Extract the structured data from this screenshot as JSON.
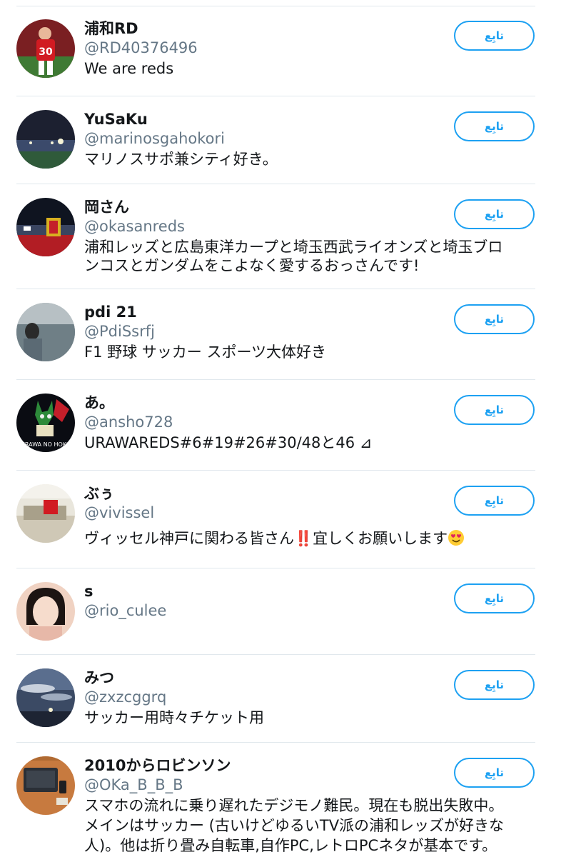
{
  "follow_label": "تابِع",
  "users": [
    {
      "name": "浦和RD",
      "handle": "@RD40376496",
      "bio": [
        "We are reds"
      ]
    },
    {
      "name": "YuSaKu",
      "handle": "@marinosgahokori",
      "bio": [
        "マリノスサポ兼シティ好き。"
      ]
    },
    {
      "name": "岡さん",
      "handle": "@okasanreds",
      "bio": [
        "浦和レッズと広島東洋カープと埼玉西武ライオンズと埼玉ブロ",
        "ンコスとガンダムをこよなく愛するおっさんです!"
      ]
    },
    {
      "name": "pdi 21",
      "handle": "@PdiSsrfj",
      "bio": [
        "F1 野球 サッカー スポーツ大体好き"
      ]
    },
    {
      "name": "あ。",
      "handle": "@ansho728",
      "bio": [
        "URAWAREDS#6#19#26#30/48と46 ⊿"
      ],
      "avatar_text": "URAWA NO HOKO"
    },
    {
      "name": "ぶぅ",
      "handle": "@vivissel",
      "bio_parts": {
        "before": "ヴィッセル神戸に関わる皆さん",
        "bang": "‼️",
        "after": "宜しくお願いします"
      }
    },
    {
      "name": "s",
      "handle": "@rio_culee",
      "bio": []
    },
    {
      "name": "みつ",
      "handle": "@zxzcggrq",
      "bio": [
        "サッカー用時々チケット用"
      ]
    },
    {
      "name": "2010からロビンソン",
      "handle": "@OKa_B_B_B",
      "bio": [
        "スマホの流れに乗り遅れたデジモノ難民。現在も脱出失敗中。",
        "メインはサッカー (古いけどゆるいTV派の浦和レッズが好きな",
        "人)。他は折り畳み自転車,自作PC,レトロPCネタが基本です。"
      ]
    }
  ],
  "colors": {
    "accent": "#1da1f2",
    "handle": "#657786",
    "divider": "#e1e8ed",
    "text": "#14171a"
  }
}
